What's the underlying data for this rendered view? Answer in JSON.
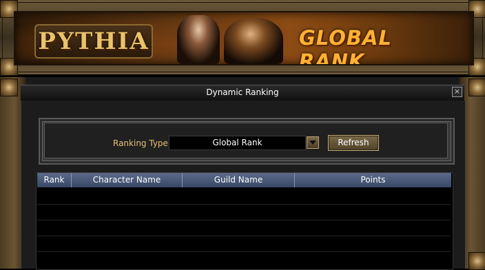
{
  "banner": {
    "logo_text": "PYTHIA",
    "title": "GLOBAL RANK"
  },
  "window": {
    "title": "Dynamic Ranking",
    "close_label": "×"
  },
  "filter": {
    "label": "Ranking Type",
    "selected": "Global Rank",
    "refresh_label": "Refresh"
  },
  "table": {
    "columns": [
      "Rank",
      "Character Name",
      "Guild Name",
      "Points"
    ],
    "rows": []
  },
  "colors": {
    "accent_orange": "#ffb232",
    "label_gold": "#e8c070",
    "header_blue": "#4a5876"
  }
}
